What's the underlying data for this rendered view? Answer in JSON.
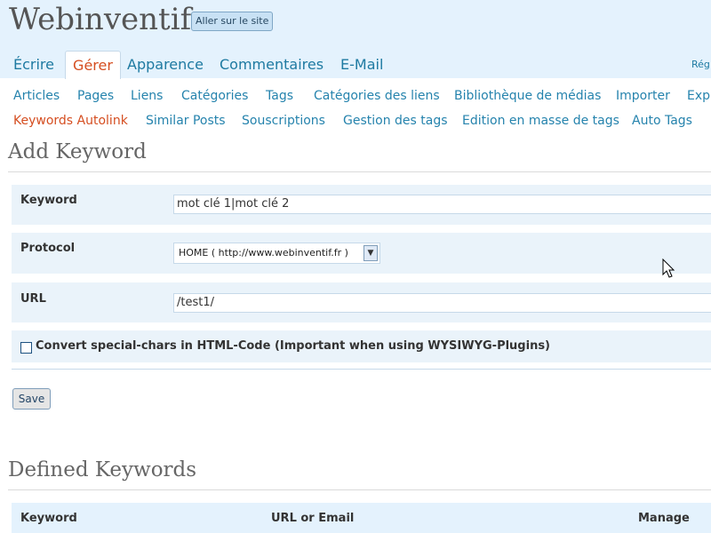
{
  "header": {
    "blog_title": "Webinventif",
    "visit_site": "Aller sur le site",
    "top_right_link": "Rég"
  },
  "main_menu": [
    {
      "label": "Écrire",
      "active": false
    },
    {
      "label": "Gérer",
      "active": true
    },
    {
      "label": "Apparence",
      "active": false
    },
    {
      "label": "Commentaires",
      "active": false
    },
    {
      "label": "E-Mail",
      "active": false
    }
  ],
  "submenu_row1": [
    "Articles",
    "Pages",
    "Liens",
    "Catégories",
    "Tags",
    "Catégories des liens",
    "Bibliothèque de médias",
    "Importer",
    "Exp"
  ],
  "submenu_row2": [
    "Keywords Autolink",
    "Similar Posts",
    "Souscriptions",
    "Gestion des tags",
    "Edition en masse de tags",
    "Auto Tags"
  ],
  "add_keyword": {
    "heading": "Add Keyword",
    "keyword_label": "Keyword",
    "keyword_value": "mot clé 1|mot clé 2",
    "protocol_label": "Protocol",
    "protocol_value": "HOME ( http://www.webinventif.fr )",
    "url_label": "URL",
    "url_value": "/test1/",
    "convert_label": "Convert special-chars in HTML-Code (Important when using WYSIWYG-Plugins)",
    "convert_checked": false,
    "save_label": "Save"
  },
  "defined_keywords": {
    "heading": "Defined Keywords",
    "columns": [
      "Keyword",
      "URL or Email",
      "Manage"
    ]
  },
  "colors": {
    "header_bg": "#e4f2fd",
    "link": "#2583ad",
    "active": "#d54e21",
    "form_row_bg": "#eaf3fa"
  }
}
